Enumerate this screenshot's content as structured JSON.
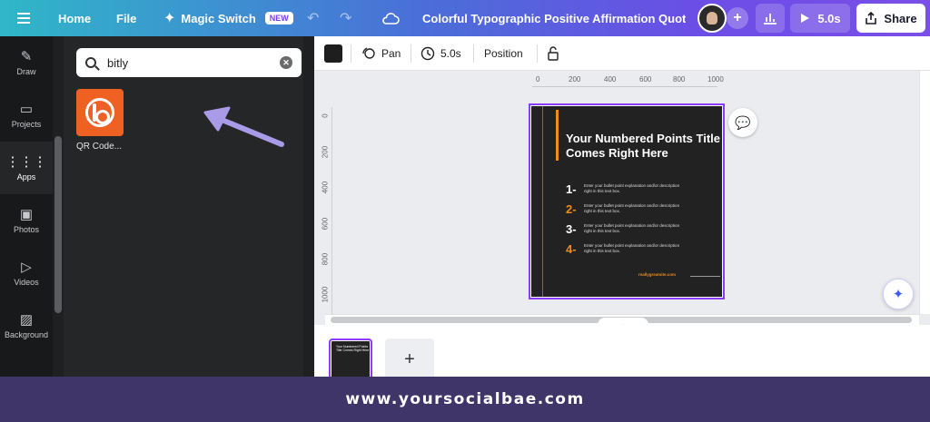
{
  "topbar": {
    "home": "Home",
    "file": "File",
    "magic_switch": "Magic Switch",
    "new_badge": "NEW",
    "doc_title": "Colorful Typographic Positive Affirmation Quote I...",
    "play_duration": "5.0s",
    "share": "Share"
  },
  "rail": {
    "items": [
      {
        "label": "Draw",
        "icon": "draw-icon"
      },
      {
        "label": "Projects",
        "icon": "folder-icon"
      },
      {
        "label": "Apps",
        "icon": "apps-grid-icon"
      },
      {
        "label": "Photos",
        "icon": "image-icon"
      },
      {
        "label": "Videos",
        "icon": "video-icon"
      },
      {
        "label": "Background",
        "icon": "background-hatch-icon"
      }
    ]
  },
  "panel": {
    "search_value": "bitly",
    "app_name": "QR Code..."
  },
  "toolbar": {
    "color": "#1e1e1e",
    "pan": "Pan",
    "duration": "5.0s",
    "position": "Position"
  },
  "ruler": {
    "top": [
      "0",
      "200",
      "400",
      "600",
      "800",
      "1000"
    ],
    "left": [
      "0",
      "200",
      "400",
      "600",
      "800",
      "1000"
    ]
  },
  "design": {
    "title": "Your Numbered Points Title Comes Right Here",
    "points": [
      {
        "num": "1-",
        "text": "Enter your bullet point explanation and/or description right in this text box.",
        "color": "#ffffff"
      },
      {
        "num": "2-",
        "text": "Enter your bullet point explanation and/or description right in this text box.",
        "color": "#ee8c1a"
      },
      {
        "num": "3-",
        "text": "Enter your bullet point explanation and/or description right in this text box.",
        "color": "#ffffff"
      },
      {
        "num": "4-",
        "text": "Enter your bullet point explanation and/or description right in this text box.",
        "color": "#ee8c1a"
      }
    ],
    "url": "reallygreatsite.com",
    "accent": "#ee8c1a"
  },
  "thumbnail": {
    "title": "Your Numbered Points Title Comes Right Here"
  },
  "footer": {
    "text": "www.yoursocialbae.com"
  },
  "colors": {
    "brand_purple": "#8b3dff",
    "footer_bg": "#3f3568",
    "app_orange": "#ee6123"
  }
}
